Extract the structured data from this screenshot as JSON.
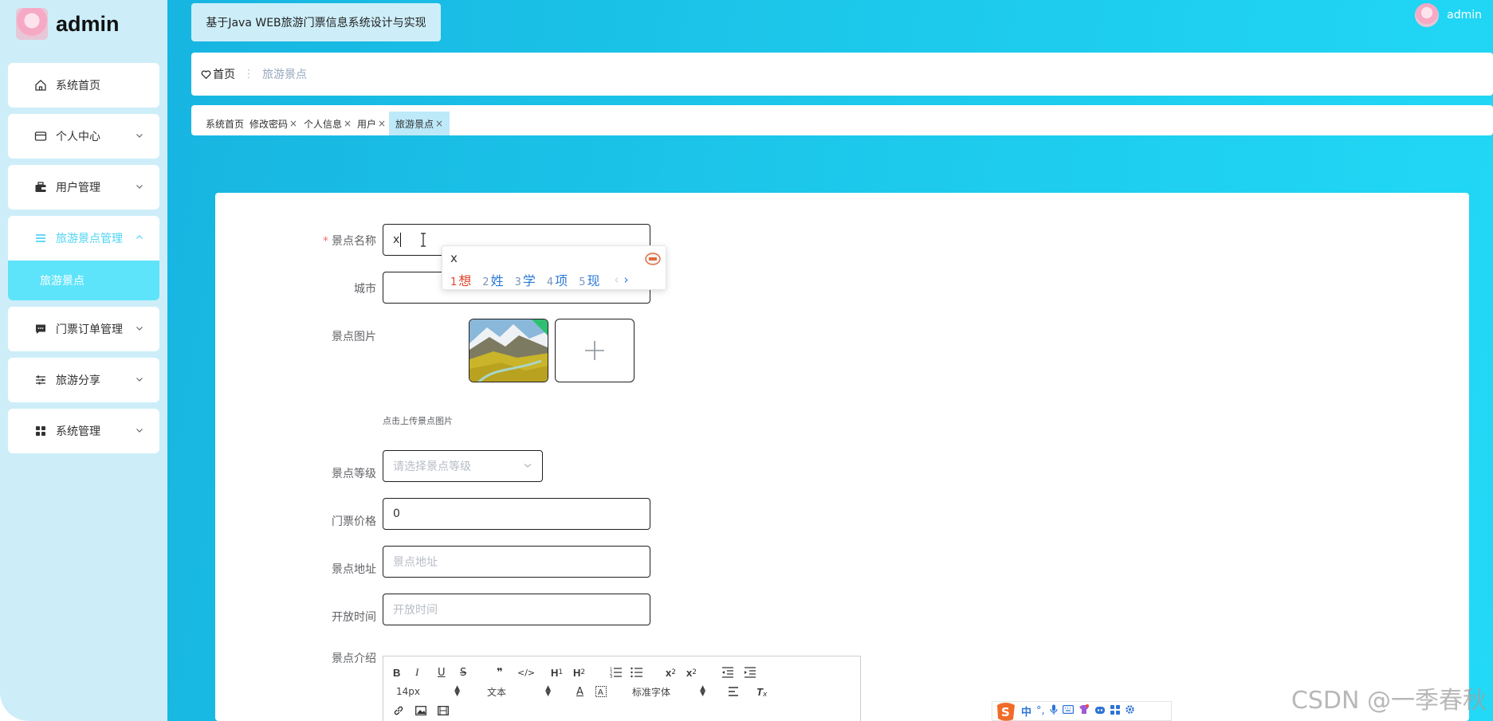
{
  "brand": {
    "name": "admin"
  },
  "header": {
    "app_title": "基于Java WEB旅游门票信息系统设计与实现",
    "user_name": "admin"
  },
  "sidebar": {
    "items": [
      {
        "label": "系统首页",
        "icon": "home-icon"
      },
      {
        "label": "个人中心",
        "icon": "wallet-icon"
      },
      {
        "label": "用户管理",
        "icon": "briefcase-icon"
      },
      {
        "label": "旅游景点管理",
        "icon": "list-icon",
        "expanded": true,
        "children": [
          {
            "label": "旅游景点"
          }
        ]
      },
      {
        "label": "门票订单管理",
        "icon": "chat-icon"
      },
      {
        "label": "旅游分享",
        "icon": "sliders-icon"
      },
      {
        "label": "系统管理",
        "icon": "grid-icon"
      }
    ]
  },
  "breadcrumb": {
    "home": "首页",
    "separator": "⋮",
    "current": "旅游景点"
  },
  "tabs": [
    {
      "label": "系统首页",
      "closable": false
    },
    {
      "label": "修改密码",
      "closable": true
    },
    {
      "label": "个人信息",
      "closable": true
    },
    {
      "label": "用户",
      "closable": true
    },
    {
      "label": "旅游景点",
      "closable": true,
      "active": true
    }
  ],
  "form": {
    "name": {
      "label": "景点名称",
      "value": "x",
      "required": true
    },
    "city": {
      "label": "城市",
      "placeholder": ""
    },
    "image": {
      "label": "景点图片",
      "hint": "点击上传景点图片"
    },
    "level": {
      "label": "景点等级",
      "placeholder": "请选择景点等级"
    },
    "price": {
      "label": "门票价格",
      "value": "0"
    },
    "address": {
      "label": "景点地址",
      "placeholder": "景点地址"
    },
    "open_time": {
      "label": "开放时间",
      "placeholder": "开放时间"
    },
    "intro": {
      "label": "景点介绍"
    }
  },
  "ime_popup": {
    "input": "x",
    "candidates": [
      {
        "n": "1",
        "text": "想"
      },
      {
        "n": "2",
        "text": "姓"
      },
      {
        "n": "3",
        "text": "学"
      },
      {
        "n": "4",
        "text": "项"
      },
      {
        "n": "5",
        "text": "现"
      }
    ]
  },
  "editor": {
    "font_size": "14px",
    "heading": "文本",
    "font_family": "标准字体"
  },
  "ime_bar": {
    "mode": "中"
  },
  "watermark": "CSDN @一季春秋",
  "colors": {
    "accent": "#1cc7ea",
    "sidebar_bg": "#cdeef9",
    "active_sub": "#5ee4fa",
    "required": "#f56c6c"
  }
}
